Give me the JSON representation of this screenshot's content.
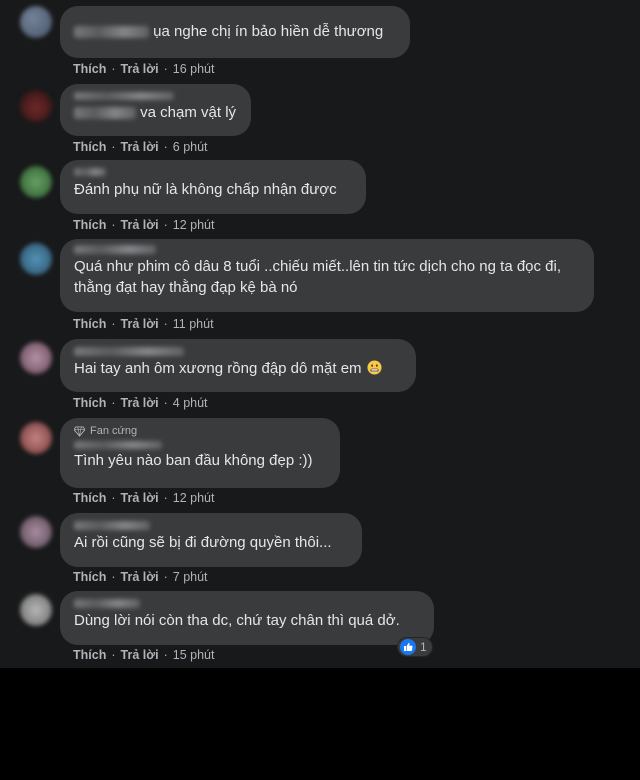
{
  "comments": [
    {
      "text": "ụa nghe chị ín bảo hiền dễ thương",
      "like": "Thích",
      "reply": "Trả lời",
      "time": "16 phút"
    },
    {
      "text": "va chạm vật lý",
      "like": "Thích",
      "reply": "Trả lời",
      "time": "6 phút"
    },
    {
      "text": "Đánh phụ nữ là không chấp nhận được",
      "like": "Thích",
      "reply": "Trả lời",
      "time": "12 phút"
    },
    {
      "text": "Quá như phim cô dâu 8 tuổi ..chiếu miết..lên tin tức dịch cho ng ta đọc đi, thằng đạt hay thằng đạp kệ bà nó",
      "like": "Thích",
      "reply": "Trả lời",
      "time": "11 phút"
    },
    {
      "text": "Hai tay anh ôm xương rồng đập dô mặt em",
      "like": "Thích",
      "reply": "Trả lời",
      "time": "4 phút"
    },
    {
      "badge": "Fan cứng",
      "text": "Tình yêu nào ban đầu không đẹp :))",
      "like": "Thích",
      "reply": "Trả lời",
      "time": "12 phút"
    },
    {
      "text": "Ai rồi cũng sẽ bị đi đường quyền thôi...",
      "like": "Thích",
      "reply": "Trả lời",
      "time": "7 phút"
    },
    {
      "text": "Dùng lời nói còn tha dc, chứ tay chân thì quá dở.",
      "like": "Thích",
      "reply": "Trả lời",
      "time": "15 phút",
      "reaction_count": "1"
    }
  ],
  "colors": {
    "bubble": "#3a3b3c",
    "background": "#18191a",
    "like_blue": "#1877f2"
  },
  "icons": {
    "badge": "diamond-icon",
    "reaction": "like-thumb-icon",
    "emoji": "grimace-emoji-icon"
  }
}
